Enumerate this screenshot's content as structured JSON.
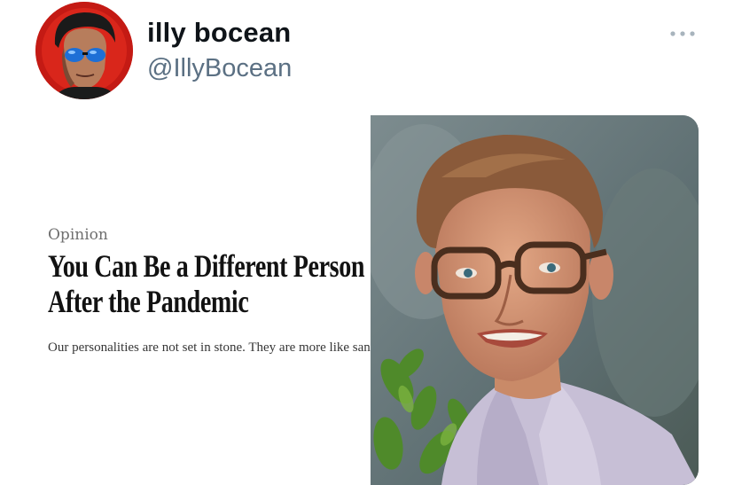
{
  "tweet": {
    "author": {
      "display_name": "illy bocean",
      "handle": "@IllyBocean",
      "avatar_icon": "avatar-portrait-sunglasses"
    },
    "more_icon": "more-dots-icon",
    "media": {
      "article": {
        "kicker": "Opinion",
        "headline": "You Can Be a Different Person After the Pandemic",
        "summary": "Our personalities are not set in stone. They are more like sand dunes."
      },
      "photo": {
        "subject": "photo-man-glasses-smiling"
      }
    }
  },
  "colors": {
    "name": "#0f1419",
    "handle": "#5b7083",
    "avatar_bg": "#c71d16",
    "background": "#ffffff"
  }
}
